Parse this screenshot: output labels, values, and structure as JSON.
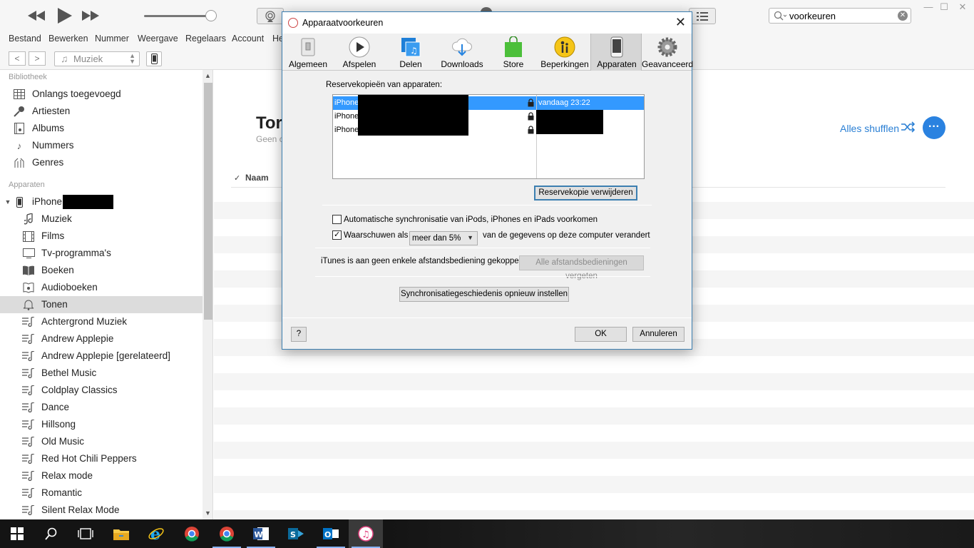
{
  "search": {
    "value": "voorkeuren"
  },
  "menubar": [
    "Bestand",
    "Bewerken",
    "Nummer",
    "Weergave",
    "Regelaars",
    "Account",
    "He"
  ],
  "nav": {
    "media_label": "Muziek"
  },
  "sidebar": {
    "library_header": "Bibliotheek",
    "library": [
      {
        "label": "Onlangs toegevoegd",
        "icon": "grid-icon"
      },
      {
        "label": "Artiesten",
        "icon": "microphone-icon"
      },
      {
        "label": "Albums",
        "icon": "album-icon"
      },
      {
        "label": "Nummers",
        "icon": "music-note-icon"
      },
      {
        "label": "Genres",
        "icon": "guitar-icon"
      }
    ],
    "devices_header": "Apparaten",
    "device_name": "iPhone",
    "device_items": [
      {
        "label": "Muziek",
        "icon": "music-note-icon"
      },
      {
        "label": "Films",
        "icon": "film-icon"
      },
      {
        "label": "Tv-programma's",
        "icon": "tv-icon"
      },
      {
        "label": "Boeken",
        "icon": "book-icon"
      },
      {
        "label": "Audioboeken",
        "icon": "audiobook-icon"
      },
      {
        "label": "Tonen",
        "icon": "bell-icon",
        "selected": true
      },
      {
        "label": "Achtergrond Muziek",
        "icon": "playlist-icon"
      },
      {
        "label": "Andrew Applepie",
        "icon": "playlist-icon"
      },
      {
        "label": "Andrew Applepie [gerelateerd]",
        "icon": "playlist-icon"
      },
      {
        "label": "Bethel Music",
        "icon": "playlist-icon"
      },
      {
        "label": "Coldplay Classics",
        "icon": "playlist-icon"
      },
      {
        "label": "Dance",
        "icon": "playlist-icon"
      },
      {
        "label": "Hillsong",
        "icon": "playlist-icon"
      },
      {
        "label": "Old Music",
        "icon": "playlist-icon"
      },
      {
        "label": "Red Hot Chili Peppers",
        "icon": "playlist-icon"
      },
      {
        "label": "Relax mode",
        "icon": "playlist-icon"
      },
      {
        "label": "Romantic",
        "icon": "playlist-icon"
      },
      {
        "label": "Silent Relax Mode",
        "icon": "playlist-icon"
      }
    ]
  },
  "content": {
    "title": "Tor",
    "subtitle": "Geen c",
    "shuffle_label": "Alles shufflen",
    "more_label": "···",
    "col_check": "✓",
    "col_name": "Naam"
  },
  "dialog": {
    "title": "Apparaatvoorkeuren",
    "tabs": [
      {
        "label": "Algemeen",
        "icon": "switch-icon"
      },
      {
        "label": "Afspelen",
        "icon": "play-icon"
      },
      {
        "label": "Delen",
        "icon": "share-icon"
      },
      {
        "label": "Downloads",
        "icon": "cloud-download-icon"
      },
      {
        "label": "Store",
        "icon": "store-bag-icon"
      },
      {
        "label": "Beperkingen",
        "icon": "parental-icon"
      },
      {
        "label": "Apparaten",
        "icon": "phone-icon",
        "active": true
      },
      {
        "label": "Geavanceerd",
        "icon": "gear-icon"
      }
    ],
    "backups_label": "Reservekopieën van apparaten:",
    "backups": [
      {
        "name": "iPhone",
        "date": "vandaag 23:22",
        "selected": true
      },
      {
        "name": "iPhone",
        "date": ""
      },
      {
        "name": "iPhone",
        "date": ""
      }
    ],
    "delete_backup": "Reservekopie verwijderen",
    "auto_sync_label": "Automatische synchronisatie van iPods, iPhones en iPads voorkomen",
    "auto_sync_checked": false,
    "warn_label": "Waarschuwen als",
    "warn_checked": true,
    "warn_option": "meer dan 5%",
    "warn_suffix": "van de gegevens op deze computer verandert",
    "remote_text": "iTunes is aan geen enkele afstandsbediening gekoppeld",
    "forget_remotes": "Alle afstandsbedieningen vergeten",
    "reset_sync": "Synchronisatiegeschiedenis opnieuw instellen",
    "help": "?",
    "ok": "OK",
    "cancel": "Annuleren"
  },
  "taskbar": [
    {
      "name": "windows-start-icon"
    },
    {
      "name": "search-icon"
    },
    {
      "name": "task-view-icon"
    },
    {
      "name": "file-explorer-icon"
    },
    {
      "name": "internet-explorer-icon"
    },
    {
      "name": "chrome-icon"
    },
    {
      "name": "chrome-icon-2"
    },
    {
      "name": "word-icon"
    },
    {
      "name": "sharepoint-icon"
    },
    {
      "name": "outlook-icon"
    },
    {
      "name": "itunes-icon",
      "active": true
    }
  ]
}
